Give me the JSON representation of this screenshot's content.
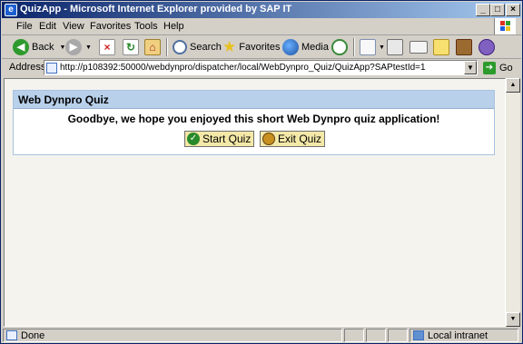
{
  "window": {
    "title": "QuizApp - Microsoft Internet Explorer provided by SAP IT",
    "controls": {
      "minimize": "_",
      "maximize": "□",
      "close": "×"
    }
  },
  "menu": {
    "items": [
      "File",
      "Edit",
      "View",
      "Favorites",
      "Tools",
      "Help"
    ]
  },
  "toolbar": {
    "back_label": "Back",
    "search_label": "Search",
    "favorites_label": "Favorites",
    "media_label": "Media"
  },
  "address": {
    "label": "Address",
    "url": "http://p108392:50000/webdynpro/dispatcher/local/WebDynpro_Quiz/QuizApp?SAPtestId=1",
    "go_label": "Go"
  },
  "page": {
    "tray_title": "Web Dynpro Quiz",
    "message": "Goodbye, we hope you enjoyed this short Web Dynpro quiz application!",
    "start_button": "Start Quiz",
    "exit_button": "Exit Quiz"
  },
  "status": {
    "text": "Done",
    "zone": "Local intranet"
  },
  "colors": {
    "titlebar_start": "#0a246a",
    "tray_header": "#b8d0ea",
    "button_bg": "#f4e8a8"
  }
}
